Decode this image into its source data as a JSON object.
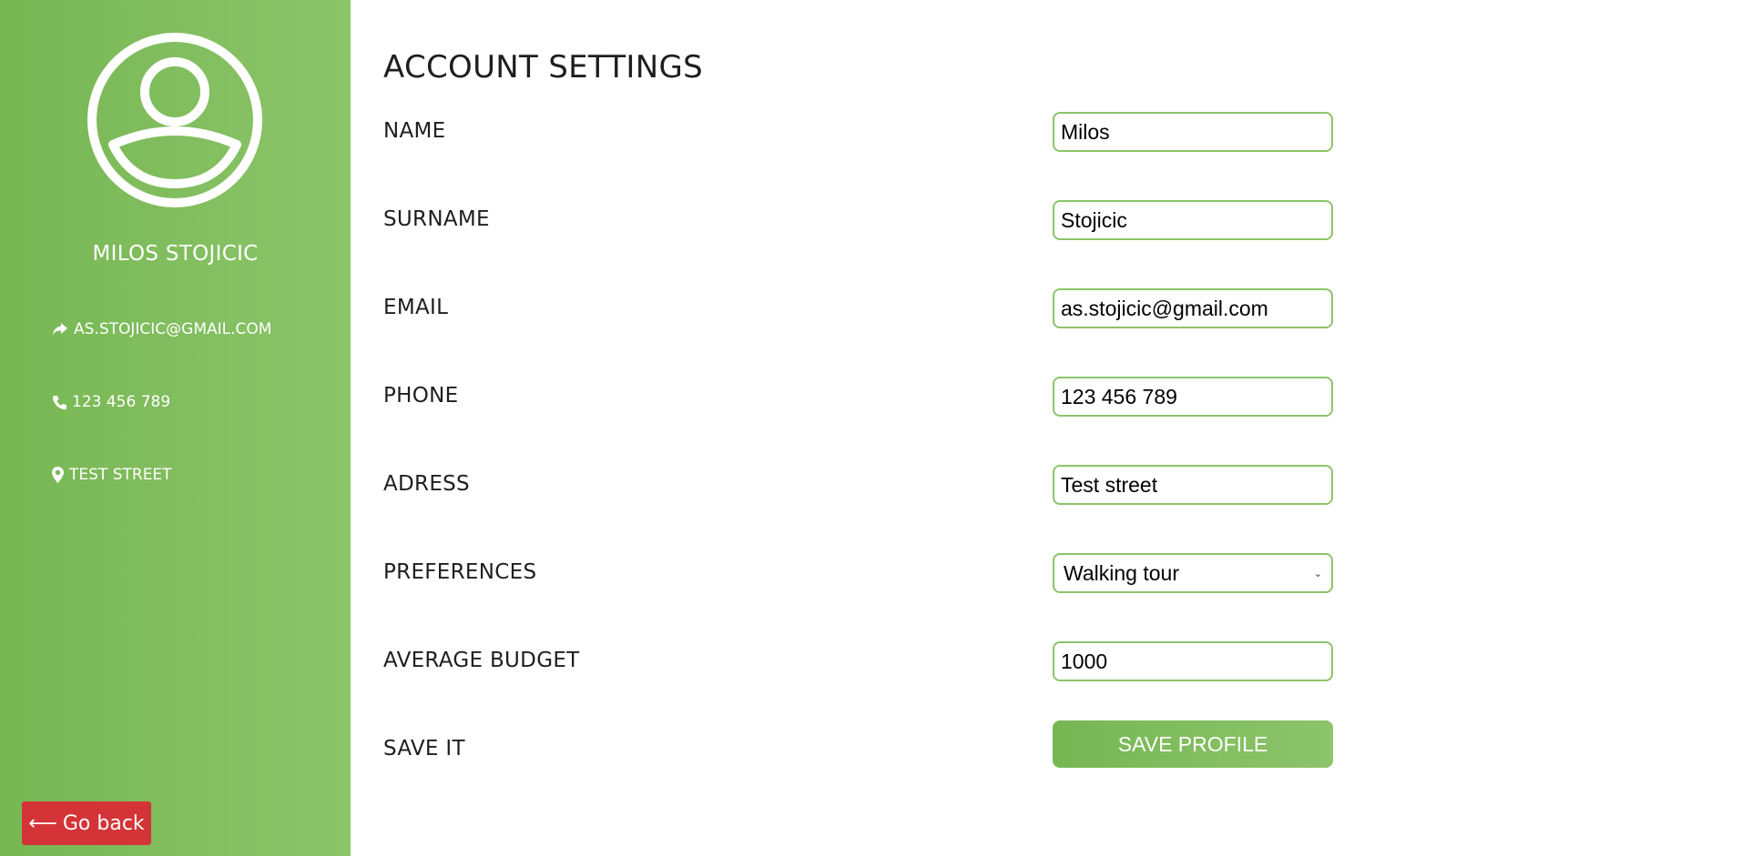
{
  "colors": {
    "sidebar_gradient_start": "#77b753",
    "sidebar_gradient_end": "#8cc46a",
    "input_border": "#8cc46a",
    "go_back_bg": "#d43437",
    "text": "#1e1e1e"
  },
  "sidebar": {
    "avatar_icon": "user-circle-icon",
    "name": "MILOS STOJICIC",
    "email": {
      "icon": "share-icon",
      "text": "AS.STOJICIC@GMAIL.COM"
    },
    "phone": {
      "icon": "phone-icon",
      "text": "123 456 789"
    },
    "address": {
      "icon": "map-marker-icon",
      "text": "TEST STREET"
    },
    "go_back": {
      "icon": "arrow-left-icon",
      "arrow": "⟵",
      "label": "Go back"
    }
  },
  "main": {
    "title": "ACCOUNT SETTINGS",
    "fields": {
      "name": {
        "label": "NAME",
        "value": "Milos"
      },
      "surname": {
        "label": "SURNAME",
        "value": "Stojicic"
      },
      "email": {
        "label": "EMAIL",
        "value": "as.stojicic@gmail.com"
      },
      "phone": {
        "label": "PHONE",
        "value": "123 456 789"
      },
      "address": {
        "label": "ADRESS",
        "value": "Test street"
      },
      "preferences": {
        "label": "PREFERENCES",
        "value": "Walking tour",
        "chevron": "⌄"
      },
      "budget": {
        "label": "AVERAGE BUDGET",
        "value": "1000"
      },
      "save": {
        "label": "SAVE IT",
        "button_label": "SAVE PROFILE"
      }
    }
  }
}
